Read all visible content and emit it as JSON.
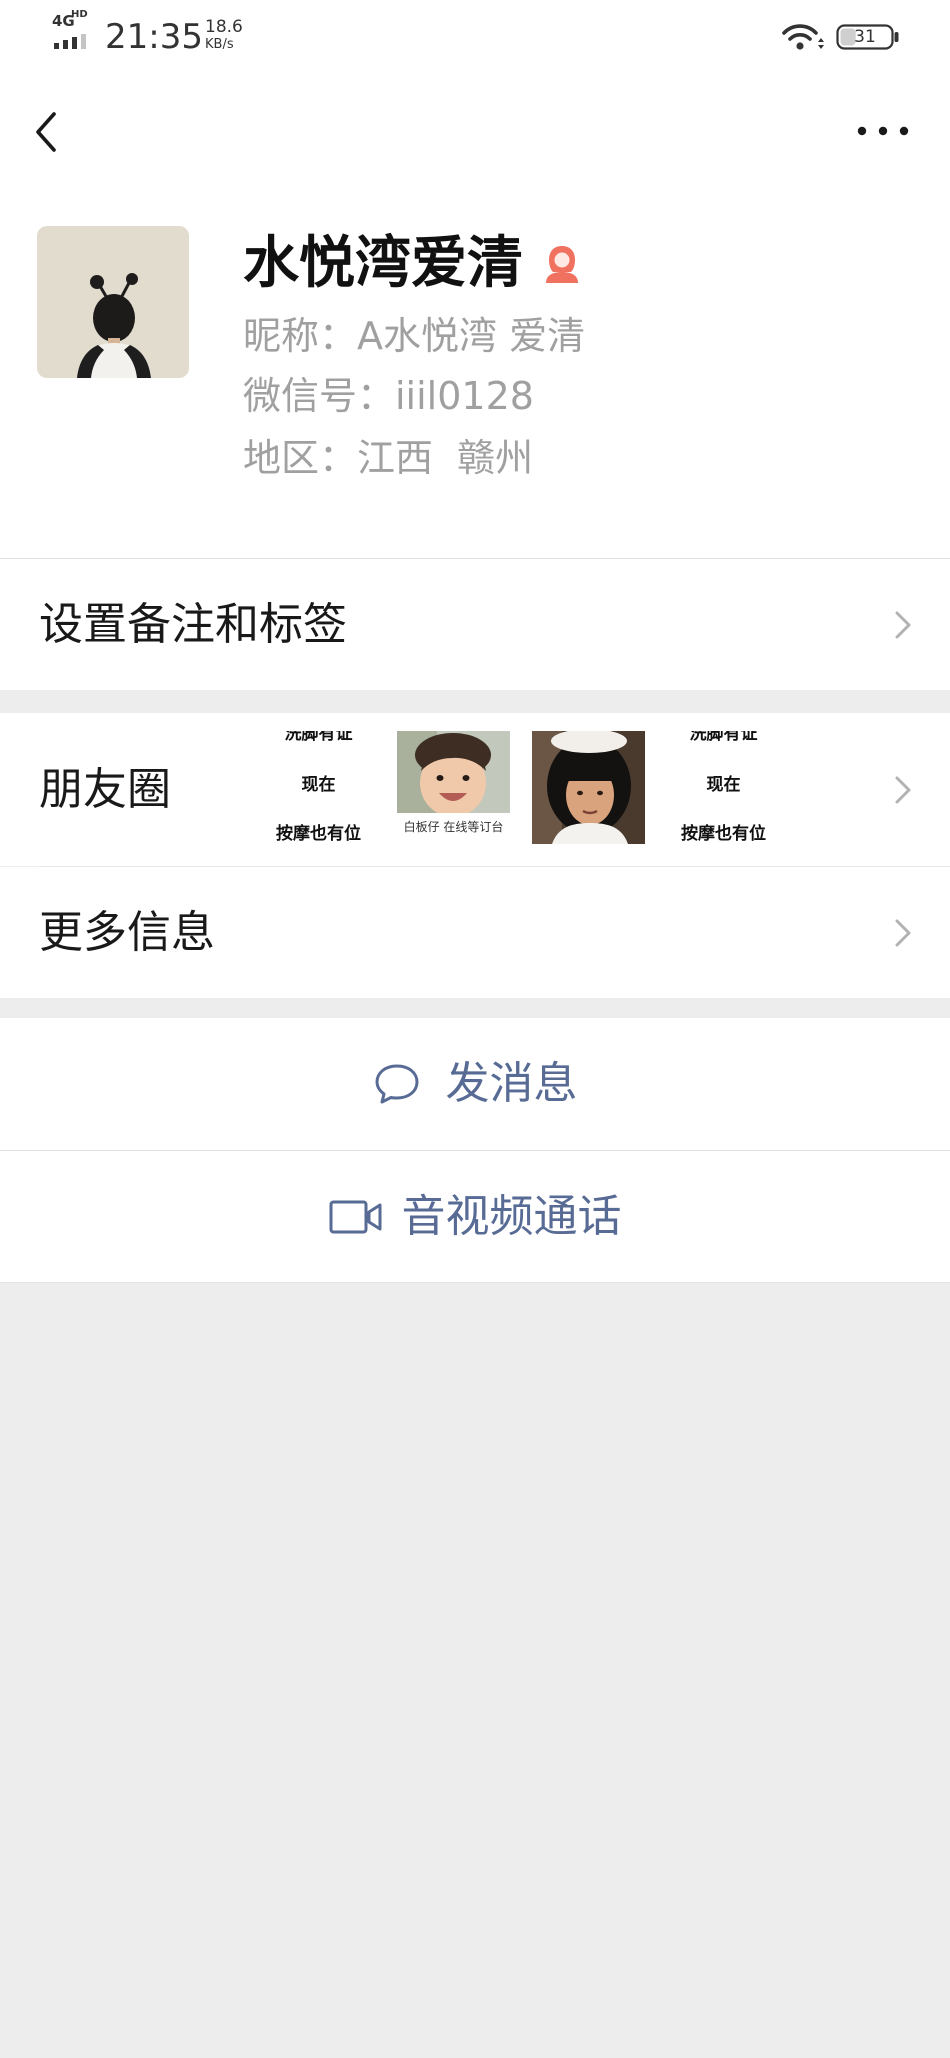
{
  "colors": {
    "accent": "#576b95",
    "female_icon": "#f0715f",
    "chevron": "#b2b2b2",
    "page_background": "#ededed"
  },
  "status_bar": {
    "network": "4G",
    "network_badge": "HD",
    "time": "21:35",
    "speed_value": "18.6",
    "speed_unit": "KB/s",
    "battery_level": 31,
    "icons": {
      "signal": "signal-bars-icon",
      "wifi": "wifi-icon",
      "battery": "battery-icon"
    }
  },
  "nav": {
    "back_icon": "chevron-left-icon",
    "more_icon": "more-dots-icon"
  },
  "profile": {
    "name": "水悦湾爱清",
    "gender_icon": "female-icon",
    "nickname": "昵称：A水悦湾 爱清",
    "wechat_id": "微信号：iiil0128",
    "region": "地区：江西  赣州"
  },
  "rows": {
    "remark_tags": "设置备注和标签",
    "moments": "朋友圈",
    "more_info": "更多信息",
    "chevron_icon": "chevron-right-icon"
  },
  "moments_thumbnails": [
    {
      "lines": [
        "洗脚有证",
        "现在",
        "按摩也有位"
      ]
    },
    {
      "caption": "白板仔 在线等订台"
    },
    {
      "caption": ""
    },
    {
      "lines": [
        "洗脚有证",
        "现在",
        "按摩也有位"
      ]
    }
  ],
  "actions": {
    "send_message": "发消息",
    "send_message_icon": "chat-bubble-icon",
    "av_call": "音视频通话",
    "av_call_icon": "video-camera-icon"
  }
}
